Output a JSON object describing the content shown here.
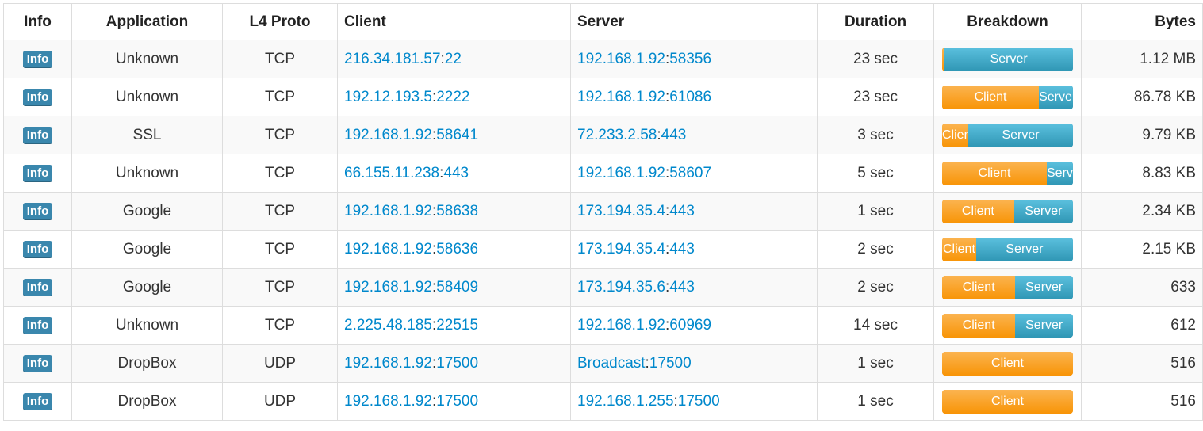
{
  "columns": {
    "info": "Info",
    "application": "Application",
    "l4_proto": "L4 Proto",
    "client": "Client",
    "server": "Server",
    "duration": "Duration",
    "breakdown": "Breakdown",
    "bytes": "Bytes"
  },
  "colors": {
    "info_badge": "#3a87ad",
    "link": "#0088cc",
    "client_bar": "#f89406",
    "server_bar": "#2f96b4"
  },
  "rows": [
    {
      "info": "Info",
      "application": "Unknown",
      "proto": "TCP",
      "client_host": "216.34.181.57",
      "client_port": "22",
      "server_host": "192.168.1.92",
      "server_port": "58356",
      "duration": "23 sec",
      "client_pct": 2,
      "server_pct": 98,
      "client_label": "",
      "server_label": "Server",
      "bytes": "1.12 MB"
    },
    {
      "info": "Info",
      "application": "Unknown",
      "proto": "TCP",
      "client_host": "192.12.193.5",
      "client_port": "2222",
      "server_host": "192.168.1.92",
      "server_port": "61086",
      "duration": "23 sec",
      "client_pct": 74,
      "server_pct": 26,
      "client_label": "Client",
      "server_label": "Server",
      "bytes": "86.78 KB"
    },
    {
      "info": "Info",
      "application": "SSL",
      "proto": "TCP",
      "client_host": "192.168.1.92",
      "client_port": "58641",
      "server_host": "72.233.2.58",
      "server_port": "443",
      "duration": "3 sec",
      "client_pct": 20,
      "server_pct": 80,
      "client_label": "Client",
      "server_label": "Server",
      "bytes": "9.79 KB"
    },
    {
      "info": "Info",
      "application": "Unknown",
      "proto": "TCP",
      "client_host": "66.155.11.238",
      "client_port": "443",
      "server_host": "192.168.1.92",
      "server_port": "58607",
      "duration": "5 sec",
      "client_pct": 80,
      "server_pct": 20,
      "client_label": "Client",
      "server_label": "Server",
      "bytes": "8.83 KB"
    },
    {
      "info": "Info",
      "application": "Google",
      "proto": "TCP",
      "client_host": "192.168.1.92",
      "client_port": "58638",
      "server_host": "173.194.35.4",
      "server_port": "443",
      "duration": "1 sec",
      "client_pct": 55,
      "server_pct": 45,
      "client_label": "Client",
      "server_label": "Server",
      "bytes": "2.34 KB"
    },
    {
      "info": "Info",
      "application": "Google",
      "proto": "TCP",
      "client_host": "192.168.1.92",
      "client_port": "58636",
      "server_host": "173.194.35.4",
      "server_port": "443",
      "duration": "2 sec",
      "client_pct": 26,
      "server_pct": 74,
      "client_label": "Client",
      "server_label": "Server",
      "bytes": "2.15 KB"
    },
    {
      "info": "Info",
      "application": "Google",
      "proto": "TCP",
      "client_host": "192.168.1.92",
      "client_port": "58409",
      "server_host": "173.194.35.6",
      "server_port": "443",
      "duration": "2 sec",
      "client_pct": 56,
      "server_pct": 44,
      "client_label": "Client",
      "server_label": "Server",
      "bytes": "633"
    },
    {
      "info": "Info",
      "application": "Unknown",
      "proto": "TCP",
      "client_host": "2.225.48.185",
      "client_port": "22515",
      "server_host": "192.168.1.92",
      "server_port": "60969",
      "duration": "14 sec",
      "client_pct": 56,
      "server_pct": 44,
      "client_label": "Client",
      "server_label": "Server",
      "bytes": "612"
    },
    {
      "info": "Info",
      "application": "DropBox",
      "proto": "UDP",
      "client_host": "192.168.1.92",
      "client_port": "17500",
      "server_host": "Broadcast",
      "server_port": "17500",
      "duration": "1 sec",
      "client_pct": 100,
      "server_pct": 0,
      "client_label": "Client",
      "server_label": "",
      "bytes": "516"
    },
    {
      "info": "Info",
      "application": "DropBox",
      "proto": "UDP",
      "client_host": "192.168.1.92",
      "client_port": "17500",
      "server_host": "192.168.1.255",
      "server_port": "17500",
      "duration": "1 sec",
      "client_pct": 100,
      "server_pct": 0,
      "client_label": "Client",
      "server_label": "",
      "bytes": "516"
    }
  ]
}
